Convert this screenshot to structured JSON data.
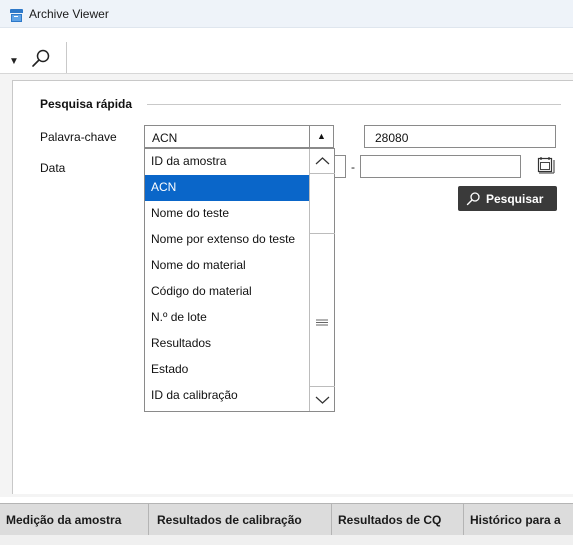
{
  "window": {
    "title": "Archive Viewer"
  },
  "toolbar": {
    "collapse_icon": "triangle-down-icon",
    "search_icon": "search-icon"
  },
  "quick_search": {
    "title": "Pesquisa rápida",
    "keyword_label": "Palavra-chave",
    "keyword_value": "ACN",
    "search_value": "28080",
    "date_label": "Data",
    "date_separator": "-",
    "search_button": "Pesquisar"
  },
  "dropdown": {
    "options": [
      "ID da amostra",
      "ACN",
      "Nome do teste",
      "Nome por extenso do teste",
      "Nome do material",
      "Código do material",
      "N.º de lote",
      "Resultados",
      "Estado",
      "ID da calibração"
    ],
    "selected": "ACN"
  },
  "tabs": [
    "Medição da amostra",
    "Resultados de calibração",
    "Resultados de CQ",
    "Histórico para a"
  ],
  "colors": {
    "accent": "#0a66c9",
    "button_bg": "#3a3a3a",
    "tabbar_bg": "#dcdcdc"
  }
}
